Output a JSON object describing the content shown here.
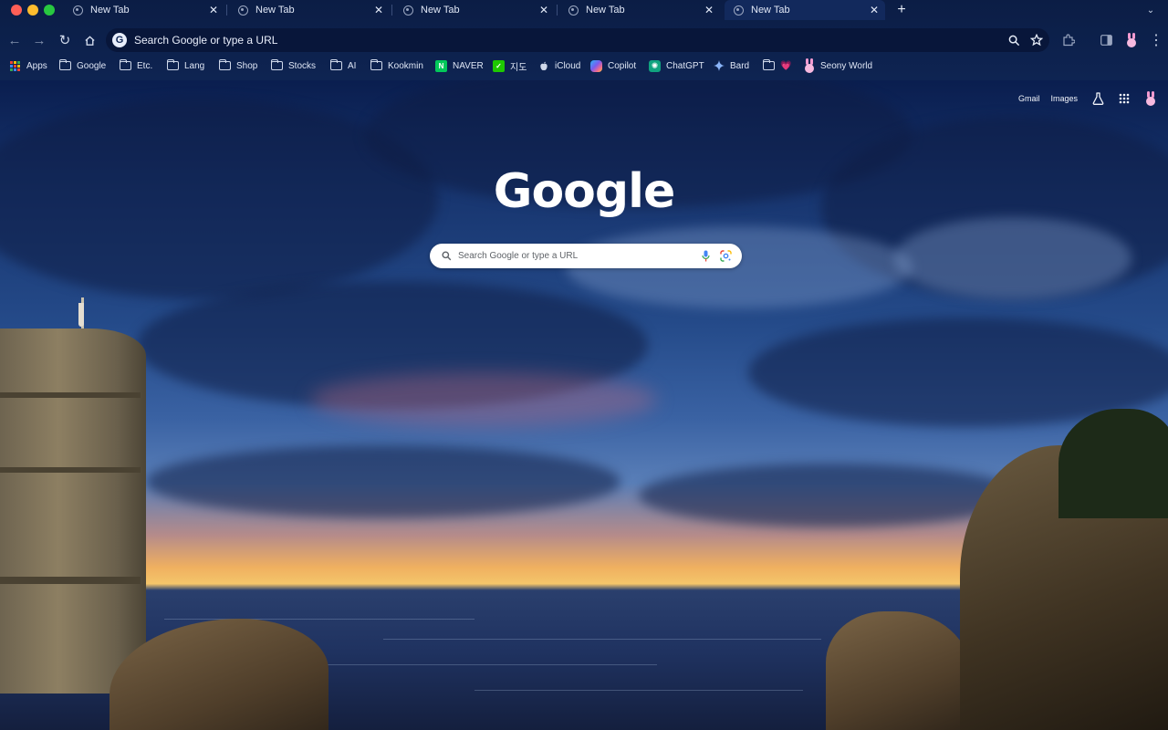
{
  "tabs": [
    {
      "title": "New Tab"
    },
    {
      "title": "New Tab"
    },
    {
      "title": "New Tab"
    },
    {
      "title": "New Tab"
    },
    {
      "title": "New Tab",
      "active": true
    }
  ],
  "toolbar": {
    "omnibox_text": "Search Google or type a URL"
  },
  "bookmarks": [
    {
      "label": "Apps",
      "icon": "apps-grid-icon"
    },
    {
      "label": "Google",
      "icon": "folder-icon"
    },
    {
      "label": "Etc.",
      "icon": "folder-icon"
    },
    {
      "label": "Lang",
      "icon": "folder-icon"
    },
    {
      "label": "Shop",
      "icon": "folder-icon"
    },
    {
      "label": "Stocks",
      "icon": "folder-icon"
    },
    {
      "label": "AI",
      "icon": "folder-icon"
    },
    {
      "label": "Kookmin",
      "icon": "folder-icon"
    },
    {
      "label": "NAVER",
      "icon": "naver-icon"
    },
    {
      "label": "지도",
      "icon": "map-icon"
    },
    {
      "label": "iCloud",
      "icon": "apple-icon"
    },
    {
      "label": "Copilot",
      "icon": "copilot-icon"
    },
    {
      "label": "ChatGPT",
      "icon": "chatgpt-icon"
    },
    {
      "label": "Bard",
      "icon": "bard-sparkle-icon"
    },
    {
      "label": "💗",
      "icon": "folder-icon"
    },
    {
      "label": "Seony World",
      "icon": "bunny-icon"
    }
  ],
  "ntp": {
    "gmail": "Gmail",
    "images": "Images",
    "logo": "Google",
    "search_placeholder": "Search Google or type a URL"
  },
  "colors": {
    "frame": "#0e2452",
    "omnibox": "#08163a",
    "accent_pink": "#f29ad0"
  }
}
